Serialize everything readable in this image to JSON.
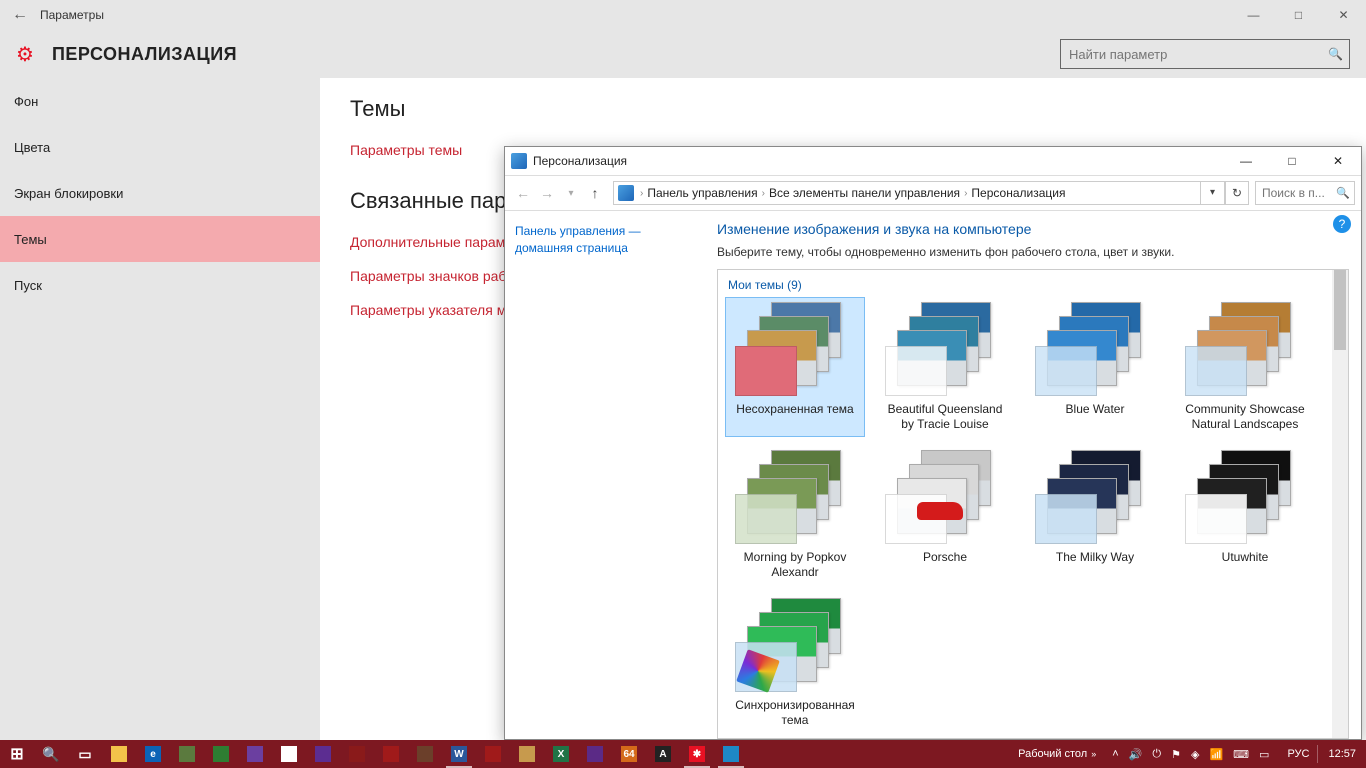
{
  "settings": {
    "app_title": "Параметры",
    "page_title": "ПЕРСОНАЛИЗАЦИЯ",
    "search_placeholder": "Найти параметр",
    "sidebar": [
      {
        "label": "Фон",
        "selected": false
      },
      {
        "label": "Цвета",
        "selected": false
      },
      {
        "label": "Экран блокировки",
        "selected": false
      },
      {
        "label": "Темы",
        "selected": true
      },
      {
        "label": "Пуск",
        "selected": false
      }
    ],
    "content": {
      "heading1": "Темы",
      "link1": "Параметры темы",
      "heading2": "Связанные параметры",
      "link2": "Дополнительные параметры звука",
      "link3": "Параметры значков рабочего стола",
      "link4": "Параметры указателя мыши"
    }
  },
  "cp": {
    "title": "Персонализация",
    "breadcrumbs": [
      "Панель управления",
      "Все элементы панели управления",
      "Персонализация"
    ],
    "search_placeholder": "Поиск в п...",
    "left_link": "Панель управления — домашняя страница",
    "headline": "Изменение изображения и звука на компьютере",
    "subline": "Выберите тему, чтобы одновременно изменить фон рабочего стола, цвет и звуки.",
    "group_label": "Мои темы (9)",
    "themes": [
      {
        "label": "Несохраненная тема",
        "accent": "#e06b78",
        "f1": "#4c78a8",
        "f2": "#5b8c67",
        "f3": "#c79a4d",
        "selected": true
      },
      {
        "label": "Beautiful Queensland by Tracie Louise",
        "accent": "rgba(255,255,255,.8)",
        "f1": "#2b6aa0",
        "f2": "#2f7f9f",
        "f3": "#3a8eb5"
      },
      {
        "label": "Blue Water",
        "accent": "rgba(200,225,245,.8)",
        "f1": "#2469a8",
        "f2": "#2b79bd",
        "f3": "#3488cf"
      },
      {
        "label": "Community Showcase Natural Landscapes",
        "accent": "rgba(200,225,245,.8)",
        "f1": "#b57d34",
        "f2": "#c6894a",
        "f3": "#d1975f"
      },
      {
        "label": "Morning by Popkov Alexandr",
        "accent": "rgba(210,225,200,.85)",
        "f1": "#5b7a3e",
        "f2": "#6b8b4a",
        "f3": "#7a9a56"
      },
      {
        "label": "Porsche",
        "accent": "rgba(255,255,255,.85)",
        "f1": "#c8c8c8",
        "f2": "#d8d8d8",
        "f3": "#e8e8e8",
        "extra": "car"
      },
      {
        "label": "The Milky Way",
        "accent": "rgba(200,225,245,.85)",
        "f1": "#141b30",
        "f2": "#1c2744",
        "f3": "#263558"
      },
      {
        "label": "Utuwhite",
        "accent": "rgba(255,255,255,.9)",
        "f1": "#101010",
        "f2": "#181818",
        "f3": "#202020"
      },
      {
        "label": "Синхронизированная тема",
        "accent": "rgba(200,225,245,.85)",
        "f1": "#1f8a3e",
        "f2": "#27a44b",
        "f3": "#2fbb58",
        "extra": "fan"
      }
    ]
  },
  "taskbar": {
    "desktop_label": "Рабочий стол",
    "lang": "РУС",
    "clock": "12:57",
    "items": [
      {
        "name": "start",
        "bg": "#ffffff",
        "glyph": "⊞"
      },
      {
        "name": "search",
        "bg": "transparent",
        "glyph": "🔍"
      },
      {
        "name": "taskview",
        "bg": "transparent",
        "glyph": "▭"
      },
      {
        "name": "explorer",
        "bg": "#f3c34a",
        "glyph": ""
      },
      {
        "name": "edge",
        "bg": "#0b63b6",
        "glyph": "e"
      },
      {
        "name": "store",
        "bg": "#5b7a3e",
        "glyph": ""
      },
      {
        "name": "app1",
        "bg": "#2e7d32",
        "glyph": ""
      },
      {
        "name": "app2",
        "bg": "#6b3fa0",
        "glyph": ""
      },
      {
        "name": "chrome",
        "bg": "#ffffff",
        "glyph": ""
      },
      {
        "name": "vs",
        "bg": "#5c2d91",
        "glyph": ""
      },
      {
        "name": "app3",
        "bg": "#8a1a1a",
        "glyph": ""
      },
      {
        "name": "calc",
        "bg": "#a01a1a",
        "glyph": ""
      },
      {
        "name": "app4",
        "bg": "#6b3f2a",
        "glyph": ""
      },
      {
        "name": "word",
        "bg": "#2b579a",
        "glyph": "W",
        "running": true
      },
      {
        "name": "app5",
        "bg": "#a01a1a",
        "glyph": ""
      },
      {
        "name": "app6",
        "bg": "#c79a4d",
        "glyph": ""
      },
      {
        "name": "excel",
        "bg": "#217346",
        "glyph": "X"
      },
      {
        "name": "app7",
        "bg": "#5b2a86",
        "glyph": ""
      },
      {
        "name": "x64",
        "bg": "#d46a1a",
        "glyph": "64"
      },
      {
        "name": "appA",
        "bg": "#222222",
        "glyph": "A"
      },
      {
        "name": "settings",
        "bg": "#e81123",
        "glyph": "✱",
        "running": true
      },
      {
        "name": "cpanel",
        "bg": "#1e88c6",
        "glyph": "",
        "running": true
      }
    ]
  }
}
